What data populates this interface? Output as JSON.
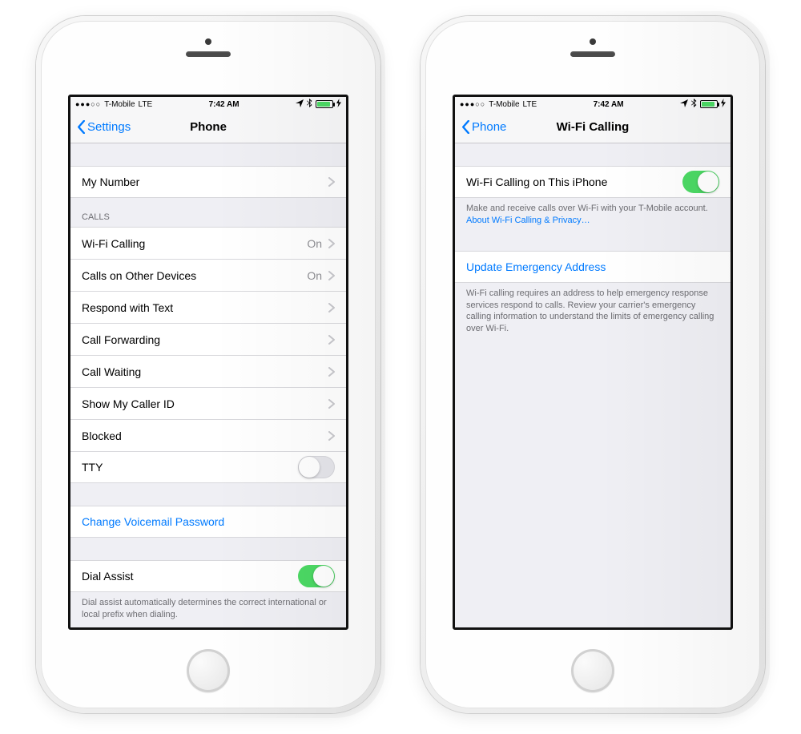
{
  "status": {
    "signal_dots": "●●●○○",
    "carrier": "T-Mobile",
    "network": "LTE",
    "time": "7:42 AM",
    "loc_icon": "➤",
    "bt_icon": "⚡",
    "charging": "⚡"
  },
  "left": {
    "back_label": "Settings",
    "title": "Phone",
    "my_number": "My Number",
    "group_calls_header": "CALLS",
    "wifi_calling": {
      "label": "Wi-Fi Calling",
      "value": "On"
    },
    "other_devices": {
      "label": "Calls on Other Devices",
      "value": "On"
    },
    "respond_text": "Respond with Text",
    "call_forwarding": "Call Forwarding",
    "call_waiting": "Call Waiting",
    "caller_id": "Show My Caller ID",
    "blocked": "Blocked",
    "tty": "TTY",
    "change_vm": "Change Voicemail Password",
    "dial_assist": "Dial Assist",
    "dial_assist_footer": "Dial assist automatically determines the correct international or local prefix when dialing."
  },
  "right": {
    "back_label": "Phone",
    "title": "Wi-Fi Calling",
    "toggle_label": "Wi-Fi Calling on This iPhone",
    "footer1_text": "Make and receive calls over Wi-Fi with your T-Mobile account.",
    "footer1_link": "About Wi-Fi Calling & Privacy…",
    "update_addr": "Update Emergency Address",
    "footer2": "Wi-Fi calling requires an address to help emergency response services respond to calls. Review your carrier's emergency calling information to understand the limits of emergency calling over Wi-Fi."
  }
}
